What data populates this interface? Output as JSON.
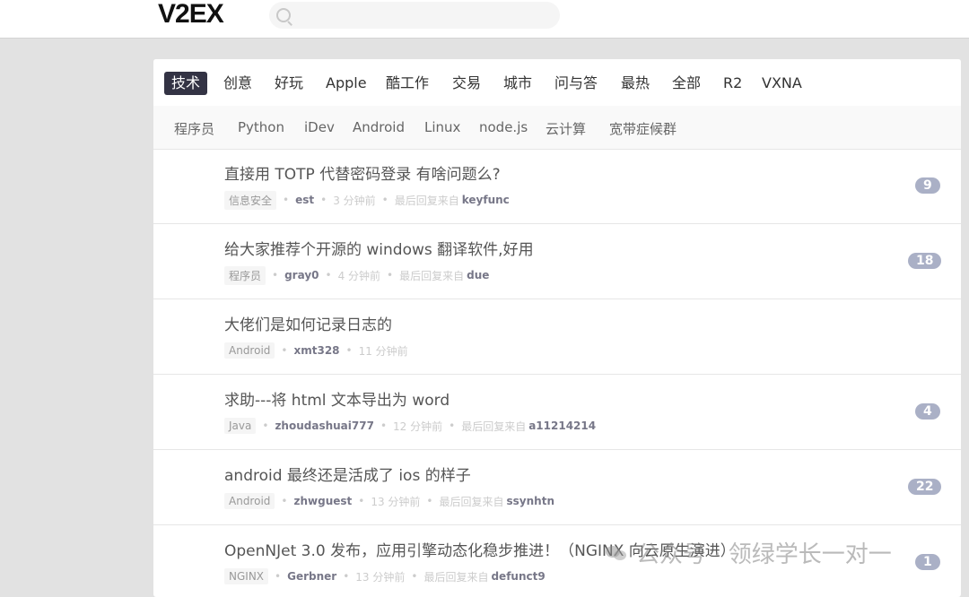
{
  "header": {
    "logo": "V2EX",
    "search_placeholder": ""
  },
  "tabs": [
    "技术",
    "创意",
    "好玩",
    "Apple",
    "酷工作",
    "交易",
    "城市",
    "问与答",
    "最热",
    "全部",
    "R2",
    "VXNA"
  ],
  "subtabs": [
    "程序员",
    "Python",
    "iDev",
    "Android",
    "Linux",
    "node.js",
    "云计算",
    "宽带症候群"
  ],
  "topics": [
    {
      "title": "直接用 TOTP 代替密码登录 有啥问题么?",
      "node": "信息安全",
      "author": "est",
      "time": "3 分钟前",
      "last_reply_label": "最后回复来自",
      "last_reply": "keyfunc",
      "replies": "9"
    },
    {
      "title": "给大家推荐个开源的 windows 翻译软件,好用",
      "node": "程序员",
      "author": "gray0",
      "time": "4 分钟前",
      "last_reply_label": "最后回复来自",
      "last_reply": "due",
      "replies": "18"
    },
    {
      "title": "大佬们是如何记录日志的",
      "node": "Android",
      "author": "xmt328",
      "time": "11 分钟前",
      "last_reply_label": "",
      "last_reply": "",
      "replies": ""
    },
    {
      "title": "求助---将 html 文本导出为 word",
      "node": "Java",
      "author": "zhoudashuai777",
      "time": "12 分钟前",
      "last_reply_label": "最后回复来自",
      "last_reply": "a11214214",
      "replies": "4"
    },
    {
      "title": "android 最终还是活成了 ios 的样子",
      "node": "Android",
      "author": "zhwguest",
      "time": "13 分钟前",
      "last_reply_label": "最后回复来自",
      "last_reply": "ssynhtn",
      "replies": "22"
    },
    {
      "title": "OpenNJet 3.0 发布，应用引擎动态化稳步推进！（NGINX 向云原生演进）",
      "node": "NGINX",
      "author": "Gerbner",
      "time": "13 分钟前",
      "last_reply_label": "最后回复来自",
      "last_reply": "defunct9",
      "replies": "1"
    }
  ],
  "watermark": "公众号 · 领绿学长一对一",
  "colors": {
    "active_tab": "#333344",
    "count_badge": "#aab0c6"
  }
}
